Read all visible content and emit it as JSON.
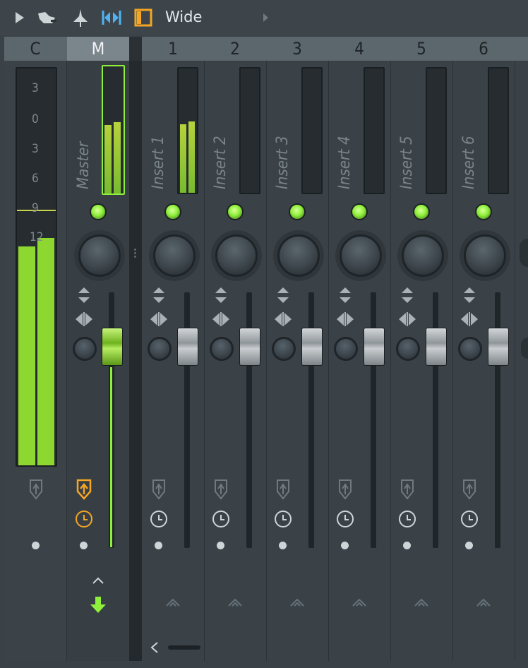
{
  "toolbar": {
    "icons": [
      "play-arrow-icon",
      "hand-brush-icon",
      "pin-icon",
      "split-arrows-icon",
      "frame-icon"
    ],
    "mode_label": "Wide",
    "more_icon": "chevron-right-icon"
  },
  "header": {
    "c_label": "C",
    "m_label": "M",
    "channels": [
      "1",
      "2",
      "3",
      "4",
      "5",
      "6"
    ]
  },
  "meter_scale": [
    "3",
    "0",
    "3",
    "6",
    "9",
    "12"
  ],
  "master": {
    "name": "Master"
  },
  "inserts": [
    "Insert 1",
    "Insert 2",
    "Insert 3",
    "Insert 4",
    "Insert 5",
    "Insert 6"
  ],
  "colors": {
    "accent_green": "#8ef03a",
    "accent_orange": "#f5a623",
    "panel": "#3a4248"
  }
}
